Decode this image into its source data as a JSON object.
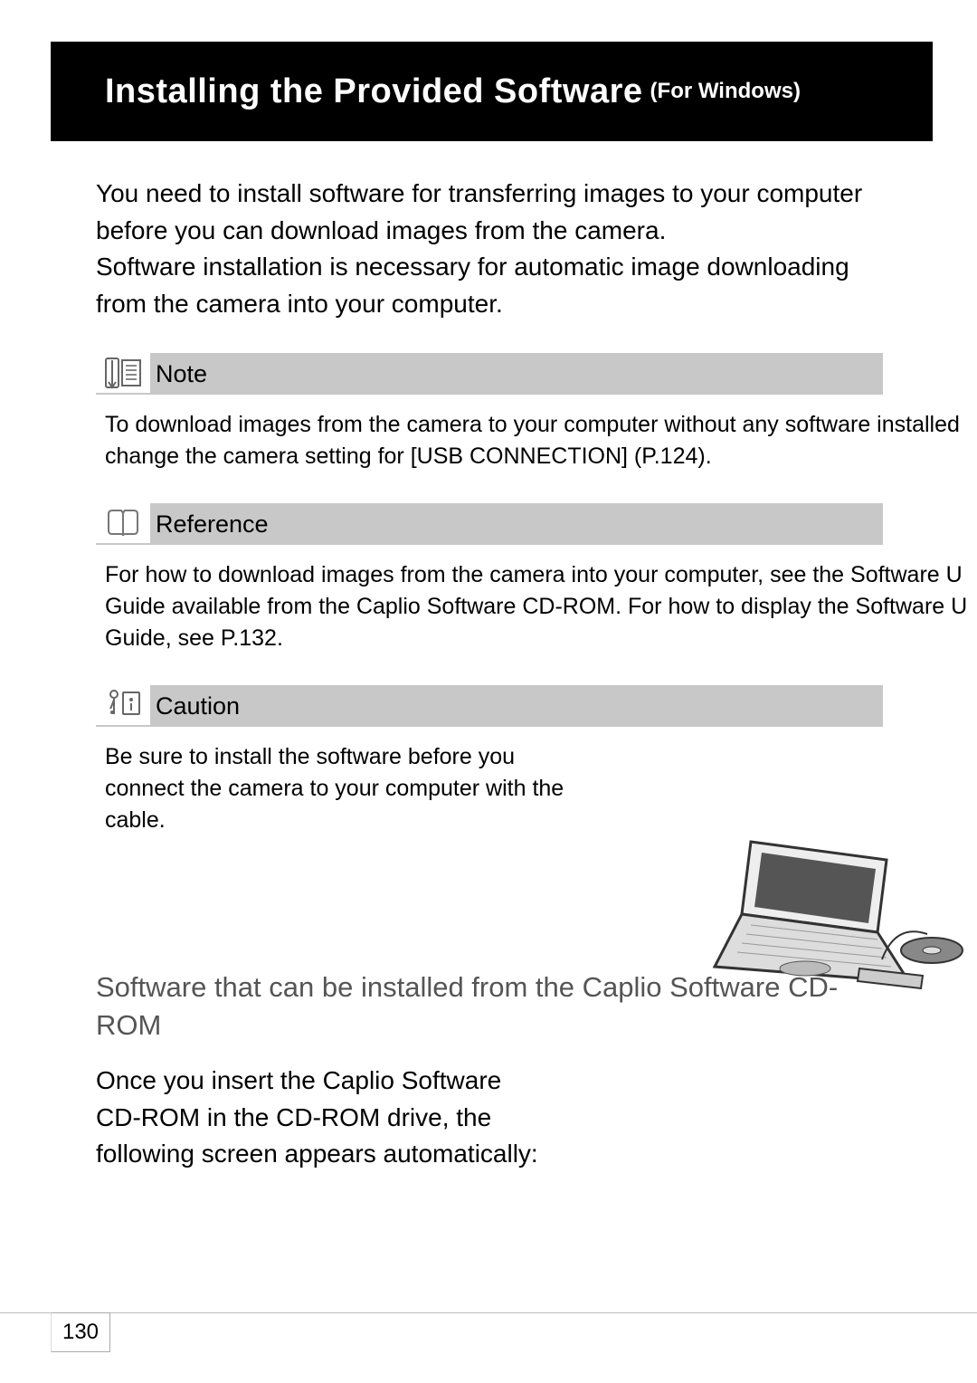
{
  "title": {
    "main": "Installing the Provided Software",
    "sub": "(For Windows)"
  },
  "intro": "You need to install software for transferring images to your computer before you can download images from the camera.\nSoftware installation is necessary for automatic image downloading from the camera into your computer.",
  "note": {
    "label": "Note",
    "body": "To download images from the camera to your computer without any software installed change the camera setting for [USB CONNECTION] (P.124)."
  },
  "reference": {
    "label": "Reference",
    "body": "For how to download images from the camera into your computer, see the Software U Guide available from the Caplio Software CD-ROM. For how to display the Software U Guide, see P.132."
  },
  "caution": {
    "label": "Caution",
    "body": "Be sure to install the software before you connect the camera to your computer with the cable."
  },
  "subhead": "Software that can be installed from the Caplio Software CD-ROM",
  "subbody": "Once you insert the Caplio Software CD-ROM in the CD-ROM drive, the following screen appears automatically:",
  "page_number": "130"
}
